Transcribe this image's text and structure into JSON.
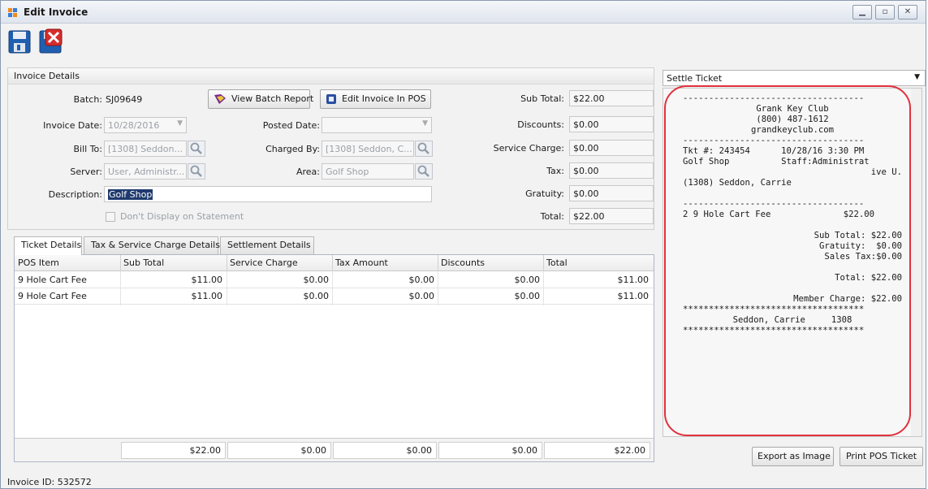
{
  "window": {
    "title": "Edit Invoice"
  },
  "toolbar": {
    "save_icon": "floppy-disk-icon",
    "cancel_icon": "close-document-icon"
  },
  "invoice_details": {
    "header": "Invoice Details",
    "batch_label": "Batch:",
    "batch_value": "SJ09649",
    "view_batch_report": "View Batch Report",
    "edit_invoice_in_pos": "Edit Invoice In POS",
    "invoice_date_label": "Invoice Date:",
    "invoice_date_value": "10/28/2016",
    "posted_date_label": "Posted Date:",
    "posted_date_value": "",
    "bill_to_label": "Bill To:",
    "bill_to_value": "[1308] Seddon...",
    "charged_by_label": "Charged By:",
    "charged_by_value": "[1308] Seddon, C...",
    "server_label": "Server:",
    "server_value": "User, Administr...",
    "area_label": "Area:",
    "area_value": "Golf Shop",
    "description_label": "Description:",
    "description_value": "Golf Shop",
    "dont_display_label": "Don't Display on Statement",
    "dont_display_checked": false
  },
  "totals": [
    {
      "label": "Sub Total:",
      "value": "$22.00"
    },
    {
      "label": "Discounts:",
      "value": "$0.00"
    },
    {
      "label": "Service Charge:",
      "value": "$0.00"
    },
    {
      "label": "Tax:",
      "value": "$0.00"
    },
    {
      "label": "Gratuity:",
      "value": "$0.00"
    },
    {
      "label": "Total:",
      "value": "$22.00"
    }
  ],
  "tabs": [
    "Ticket Details",
    "Tax & Service Charge Details",
    "Settlement Details"
  ],
  "grid": {
    "columns": [
      "POS Item",
      "Sub Total",
      "Service Charge",
      "Tax Amount",
      "Discounts",
      "Total"
    ],
    "rows": [
      [
        "9 Hole Cart Fee",
        "$11.00",
        "$0.00",
        "$0.00",
        "$0.00",
        "$11.00"
      ],
      [
        "9 Hole Cart Fee",
        "$11.00",
        "$0.00",
        "$0.00",
        "$0.00",
        "$11.00"
      ]
    ],
    "footer": [
      "$22.00",
      "$0.00",
      "$0.00",
      "$0.00",
      "$22.00"
    ]
  },
  "settle": {
    "select_value": "Settle Ticket",
    "receipt": {
      "dashes": "-----------------------------------",
      "club_name": "Grank Key Club",
      "phone": "(800) 487-1612",
      "website": "grandkeyclub.com",
      "ticket_line": "Tkt #: 243454      10/28/16 3:30 PM",
      "shop_line": "Golf Shop          Staff:Administrat",
      "staff_wrap": "ive U.",
      "member_line": "(1308) Seddon, Carrie",
      "item_line": "2 9 Hole Cart Fee              $22.00",
      "sub_total": "Sub Total: $22.00",
      "gratuity": "Gratuity:  $0.00",
      "sales_tax": "Sales Tax:$0.00",
      "total": "Total: $22.00",
      "member_charge": "Member Charge: $22.00",
      "stars": "***********************************",
      "signature_line": "Seddon, Carrie     1308"
    },
    "export_button": "Export as Image",
    "print_button": "Print POS Ticket"
  },
  "status": {
    "invoice_id": "Invoice ID: 532572"
  },
  "colors": {
    "highlight_outline": "#e0313c",
    "selection": "#1f3a6e"
  }
}
